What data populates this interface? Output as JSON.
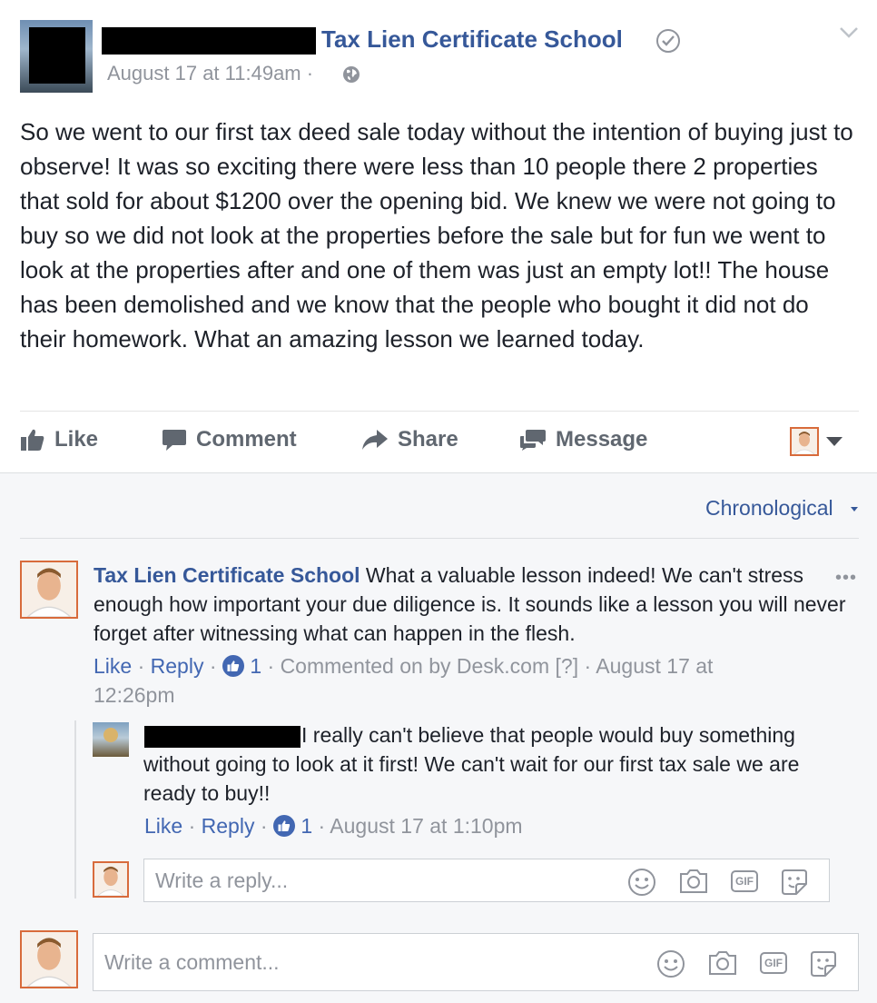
{
  "post": {
    "page_name": "Tax Lien Certificate School",
    "timestamp": "August 17 at 11:49am",
    "separator": "·",
    "body": "So we went to our first tax deed sale today without the intention of buying just to observe! It was so exciting there were less than 10 people there 2 properties that sold for about $1200 over the opening bid. We knew we were not going to buy so we did not look at the properties before the sale but for fun we went to look at the properties after and one of them was just an empty lot!! The house has been demolished and we know that the people who bought it did not do their homework. What an amazing lesson we learned today.",
    "actions": {
      "like": "Like",
      "comment": "Comment",
      "share": "Share",
      "message": "Message"
    }
  },
  "comments": {
    "sort_label": "Chronological",
    "items": [
      {
        "author": "Tax Lien Certificate School",
        "text": " What a valuable lesson indeed! We can't stress enough how important your due diligence is. It sounds like a lesson you will never forget after witnessing what can happen in the flesh.",
        "more": "•••",
        "like": "Like",
        "reply": "Reply",
        "like_count": "1",
        "via": "Commented on by Desk.com",
        "help": "[?]",
        "time": "August 17 at 12:26pm"
      }
    ],
    "replies": [
      {
        "text": "I really can't believe that people would buy something without going to look at it first! We can't wait for our first tax sale we are ready to buy!!",
        "like": "Like",
        "reply": "Reply",
        "like_count": "1",
        "time": "August 17 at 1:10pm"
      }
    ],
    "reply_placeholder": "Write a reply...",
    "comment_placeholder": "Write a comment...",
    "input_icons": [
      "emoji-icon",
      "camera-icon",
      "gif-icon",
      "sticker-icon"
    ],
    "gif_label": "GIF"
  },
  "colors": {
    "link": "#365899",
    "meta": "#90949c",
    "accent_border": "#d86b3b"
  }
}
